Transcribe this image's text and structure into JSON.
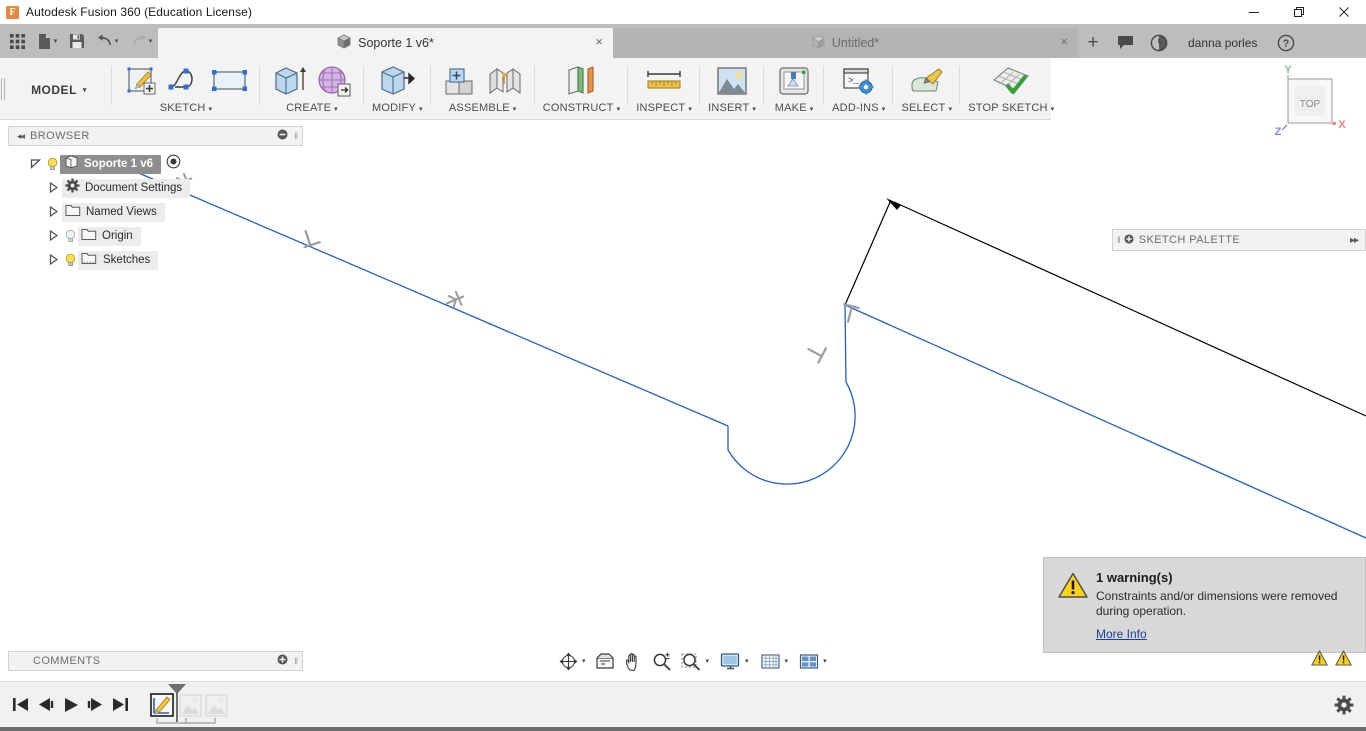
{
  "window": {
    "app_title": "Autodesk Fusion 360 (Education License)",
    "logo_letter": "F",
    "minimize_label": "Minimize",
    "maximize_label": "Restore",
    "close_label": "Close"
  },
  "quick_access": {
    "grid_label": "Show Data Panel",
    "new_label": "New Design",
    "save_label": "Save",
    "undo_label": "Undo",
    "redo_label": "Redo"
  },
  "tabs": {
    "items": [
      {
        "label": "Soporte 1 v6*",
        "active": true,
        "close": "×"
      },
      {
        "label": "Untitled*",
        "active": false,
        "close": "×"
      }
    ],
    "new_tab": "+",
    "user": "danna porles",
    "job_status_icon": "clock-icon",
    "comments_icon": "comment-icon",
    "help_icon": "help-icon"
  },
  "ribbon": {
    "workspace": "MODEL",
    "caret": "▾",
    "panels": [
      {
        "name": "SKETCH",
        "label": "SKETCH",
        "icons": [
          "create-sketch-icon",
          "spline-icon",
          "rectangle-icon"
        ]
      },
      {
        "name": "CREATE",
        "label": "CREATE",
        "icons": [
          "extrude-icon",
          "create-form-icon"
        ]
      },
      {
        "name": "MODIFY",
        "label": "MODIFY",
        "icons": [
          "press-pull-icon"
        ]
      },
      {
        "name": "ASSEMBLE",
        "label": "ASSEMBLE",
        "icons": [
          "new-component-icon",
          "joint-icon"
        ]
      },
      {
        "name": "CONSTRUCT",
        "label": "CONSTRUCT",
        "icons": [
          "offset-plane-icon"
        ]
      },
      {
        "name": "INSPECT",
        "label": "INSPECT",
        "icons": [
          "measure-icon"
        ]
      },
      {
        "name": "INSERT",
        "label": "INSERT",
        "icons": [
          "insert-canvas-icon"
        ]
      },
      {
        "name": "MAKE",
        "label": "MAKE",
        "icons": [
          "3d-print-icon"
        ]
      },
      {
        "name": "ADD-INS",
        "label": "ADD-INS",
        "icons": [
          "scripts-addins-icon"
        ]
      },
      {
        "name": "SELECT",
        "label": "SELECT",
        "icons": [
          "select-icon"
        ]
      },
      {
        "name": "STOP SKETCH",
        "label": "STOP SKETCH",
        "icons": [
          "stop-sketch-icon"
        ]
      }
    ]
  },
  "browser": {
    "title": "BROWSER",
    "collapse_icon": "◂◂",
    "settings_icon": "⚫",
    "tree": [
      {
        "label": "Soporte 1 v6",
        "selected": true,
        "arrow": "◢",
        "bulb": true,
        "type": "document",
        "radio": true
      },
      {
        "label": "Document Settings",
        "selected": false,
        "arrow": "▷",
        "bulb": false,
        "type": "gear"
      },
      {
        "label": "Named Views",
        "selected": false,
        "arrow": "▷",
        "bulb": false,
        "type": "folder"
      },
      {
        "label": "Origin",
        "selected": false,
        "arrow": "▷",
        "bulb": true,
        "bulb_off": true,
        "type": "folder"
      },
      {
        "label": "Sketches",
        "selected": false,
        "arrow": "▷",
        "bulb": true,
        "type": "sketch-folder"
      }
    ]
  },
  "sketch_palette": {
    "title": "SKETCH PALETTE",
    "grip_icon": "‖",
    "pin_icon": "⊕",
    "expand_icon": "▸▸"
  },
  "viewcube": {
    "face_label": "TOP",
    "axis_x": "X",
    "axis_y": "Y",
    "axis_z": "Z",
    "color_x": "#f08080",
    "color_y": "#7ece7e",
    "color_z": "#8080f0"
  },
  "warning": {
    "title": "1 warning(s)",
    "message": "Constraints and/or dimensions were removed during operation.",
    "link": "More Info",
    "icon": "warning-triangle-icon",
    "icon_color": "#ffd11a"
  },
  "comments": {
    "title": "COMMENTS",
    "add_icon": "⊕"
  },
  "navbar": {
    "items": [
      {
        "name": "orbit-icon",
        "caret": true
      },
      {
        "name": "look-at-icon",
        "caret": false
      },
      {
        "name": "pan-icon",
        "caret": false
      },
      {
        "name": "zoom-icon",
        "caret": false
      },
      {
        "name": "zoom-window-icon",
        "caret": true
      },
      {
        "name": "display-settings-icon",
        "caret": true
      },
      {
        "name": "grid-snaps-icon",
        "caret": true
      },
      {
        "name": "viewports-icon",
        "caret": true
      }
    ]
  },
  "status_bar": {
    "warnings": [
      "warning-triangle-icon",
      "warning-triangle-icon"
    ]
  },
  "timeline": {
    "controls": [
      "go-to-beginning-icon",
      "step-back-icon",
      "play-icon",
      "step-forward-icon",
      "go-to-end-icon"
    ],
    "features": [
      "sketch-feature-icon",
      "feature-placeholder-icon",
      "feature-placeholder-icon"
    ],
    "settings_icon": "gear-icon"
  },
  "sketch": {
    "colors": {
      "sketch_line": "#1f5fdd",
      "construction_black": "#000000",
      "constraint_glyph": "#9a9a9a"
    },
    "profile_description": "Open sketch profile with two long diagonal lines, a slot/keyhole arc and a perpendicular dimension leader",
    "constraint_count": 5,
    "constraint_types": [
      "tangent",
      "perpendicular",
      "tangent",
      "perpendicular",
      "perpendicular"
    ]
  }
}
